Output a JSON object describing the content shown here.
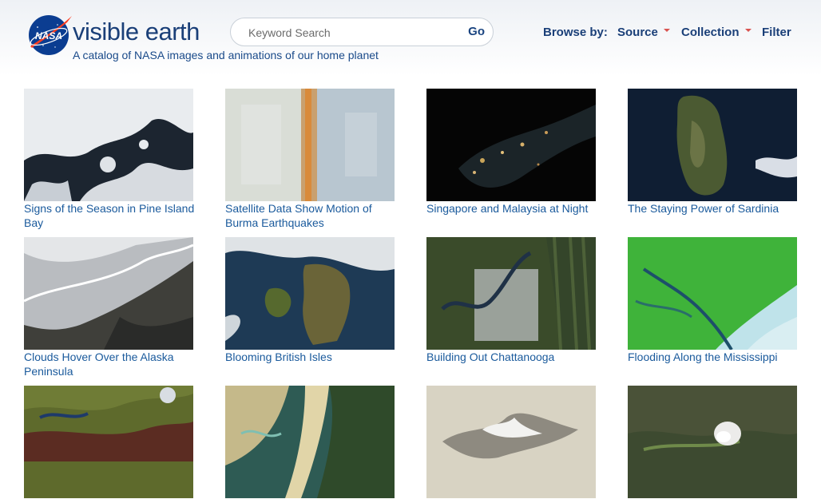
{
  "header": {
    "logo_alt": "NASA",
    "site_title": "visible earth",
    "tagline": "A catalog of NASA images and animations of our home planet"
  },
  "search": {
    "placeholder": "Keyword Search",
    "go_label": "Go"
  },
  "nav": {
    "browse_label": "Browse by:",
    "source_label": "Source",
    "collection_label": "Collection",
    "filter_label": "Filter"
  },
  "cards": [
    {
      "title": "Signs of the Season in Pine Island Bay"
    },
    {
      "title": "Satellite Data Show Motion of Burma Earthquakes"
    },
    {
      "title": "Singapore and Malaysia at Night"
    },
    {
      "title": "The Staying Power of Sardinia"
    },
    {
      "title": "Clouds Hover Over the Alaska Peninsula"
    },
    {
      "title": "Blooming British Isles"
    },
    {
      "title": "Building Out Chattanooga"
    },
    {
      "title": "Flooding Along the Mississippi"
    },
    {
      "title": ""
    },
    {
      "title": ""
    },
    {
      "title": ""
    },
    {
      "title": ""
    }
  ],
  "colors": {
    "brand": "#1a3f78",
    "link": "#1a5a9c",
    "caret": "#d9534f",
    "nasa_blue": "#0b3d91",
    "nasa_red": "#fc3d21"
  }
}
